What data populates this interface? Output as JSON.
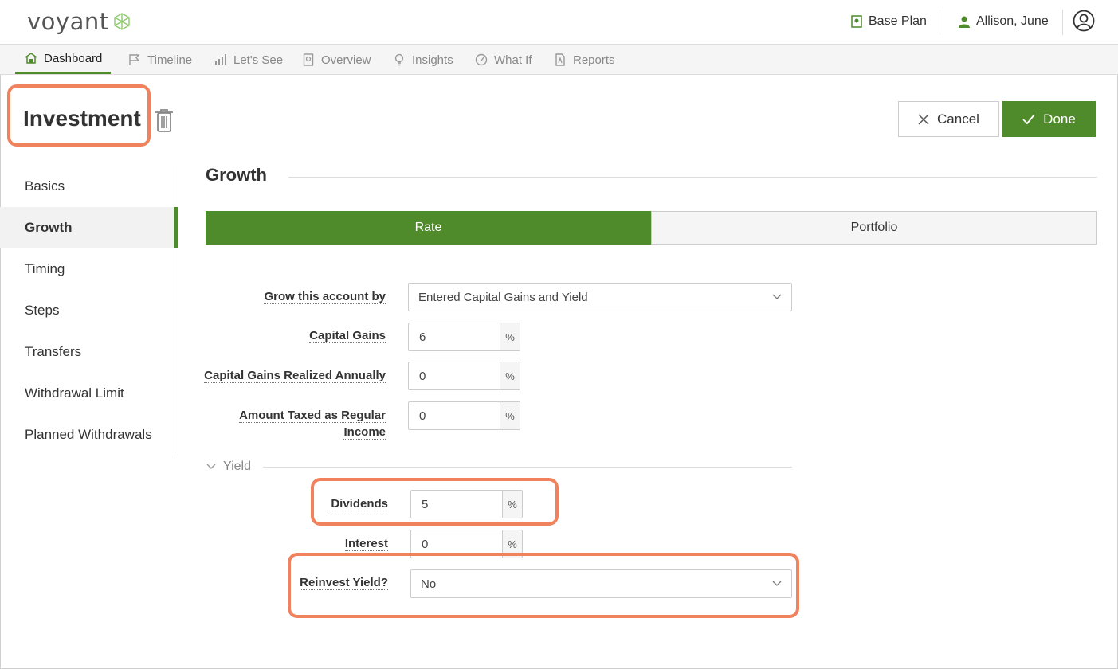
{
  "header": {
    "brand": "voyant",
    "plan_label": "Base Plan",
    "user_name": "Allison, June"
  },
  "nav": [
    {
      "label": "Dashboard",
      "icon": "home-icon",
      "active": true
    },
    {
      "label": "Timeline",
      "icon": "flag-icon"
    },
    {
      "label": "Let's See",
      "icon": "bar-chart-icon"
    },
    {
      "label": "Overview",
      "icon": "document-icon"
    },
    {
      "label": "Insights",
      "icon": "lightbulb-icon"
    },
    {
      "label": "What If",
      "icon": "gauge-icon"
    },
    {
      "label": "Reports",
      "icon": "pdf-icon"
    }
  ],
  "page": {
    "title": "Investment",
    "cancel_label": "Cancel",
    "done_label": "Done"
  },
  "sidebar": {
    "items": [
      {
        "label": "Basics"
      },
      {
        "label": "Growth",
        "active": true
      },
      {
        "label": "Timing"
      },
      {
        "label": "Steps"
      },
      {
        "label": "Transfers"
      },
      {
        "label": "Withdrawal Limit"
      },
      {
        "label": "Planned Withdrawals"
      }
    ]
  },
  "growth": {
    "title": "Growth",
    "tabs": [
      {
        "label": "Rate",
        "active": true
      },
      {
        "label": "Portfolio"
      }
    ],
    "grow_by_label": "Grow this account by",
    "grow_by_value": "Entered Capital Gains and Yield",
    "capital_gains_label": "Capital Gains",
    "capital_gains_value": "6",
    "cg_realized_label": "Capital Gains Realized Annually",
    "cg_realized_value": "0",
    "taxed_regular_label_1": "Amount Taxed as Regular",
    "taxed_regular_label_2": "Income",
    "taxed_regular_value": "0",
    "unit": "%",
    "yield_title": "Yield",
    "dividends_label": "Dividends",
    "dividends_value": "5",
    "interest_label": "Interest",
    "interest_value": "0",
    "reinvest_label": "Reinvest Yield?",
    "reinvest_value": "No"
  },
  "colors": {
    "accent": "#4f8a2b",
    "highlight": "#f0825e"
  }
}
